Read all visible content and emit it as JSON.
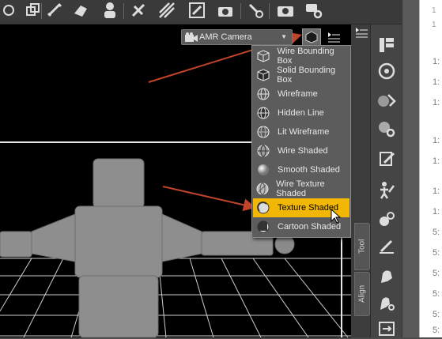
{
  "camera": {
    "label": "AMR Camera"
  },
  "draw_style_menu": {
    "items": [
      {
        "label": "Wire Bounding Box",
        "icon": "wire-bounding-box-icon",
        "selected": false
      },
      {
        "label": "Solid Bounding Box",
        "icon": "solid-bounding-box-icon",
        "selected": false
      },
      {
        "label": "Wireframe",
        "icon": "wireframe-icon",
        "selected": false
      },
      {
        "label": "Hidden Line",
        "icon": "hidden-line-icon",
        "selected": false
      },
      {
        "label": "Lit Wireframe",
        "icon": "lit-wireframe-icon",
        "selected": false
      },
      {
        "label": "Wire Shaded",
        "icon": "wire-shaded-icon",
        "selected": false
      },
      {
        "label": "Smooth Shaded",
        "icon": "smooth-shaded-icon",
        "selected": false
      },
      {
        "label": "Wire Texture Shaded",
        "icon": "wire-texture-shaded-icon",
        "selected": false
      },
      {
        "label": "Texture Shaded",
        "icon": "texture-shaded-icon",
        "selected": true
      },
      {
        "label": "Cartoon Shaded",
        "icon": "cartoon-shaded-icon",
        "selected": false
      }
    ]
  },
  "side_tabs": {
    "tool": "Tool",
    "align": "Align"
  },
  "doc_gutter": {
    "top_marks": [
      "1",
      "1"
    ],
    "rows": [
      "1:",
      "1:",
      "1:",
      "1:",
      "1:",
      "1:",
      "1:",
      "5:",
      "5:",
      "5:",
      "5:",
      "5:",
      "5:",
      "5:"
    ]
  },
  "colors": {
    "highlight": "#f2b705",
    "annotation_arrow": "#c0442a",
    "viewport_bg": "#000000"
  }
}
